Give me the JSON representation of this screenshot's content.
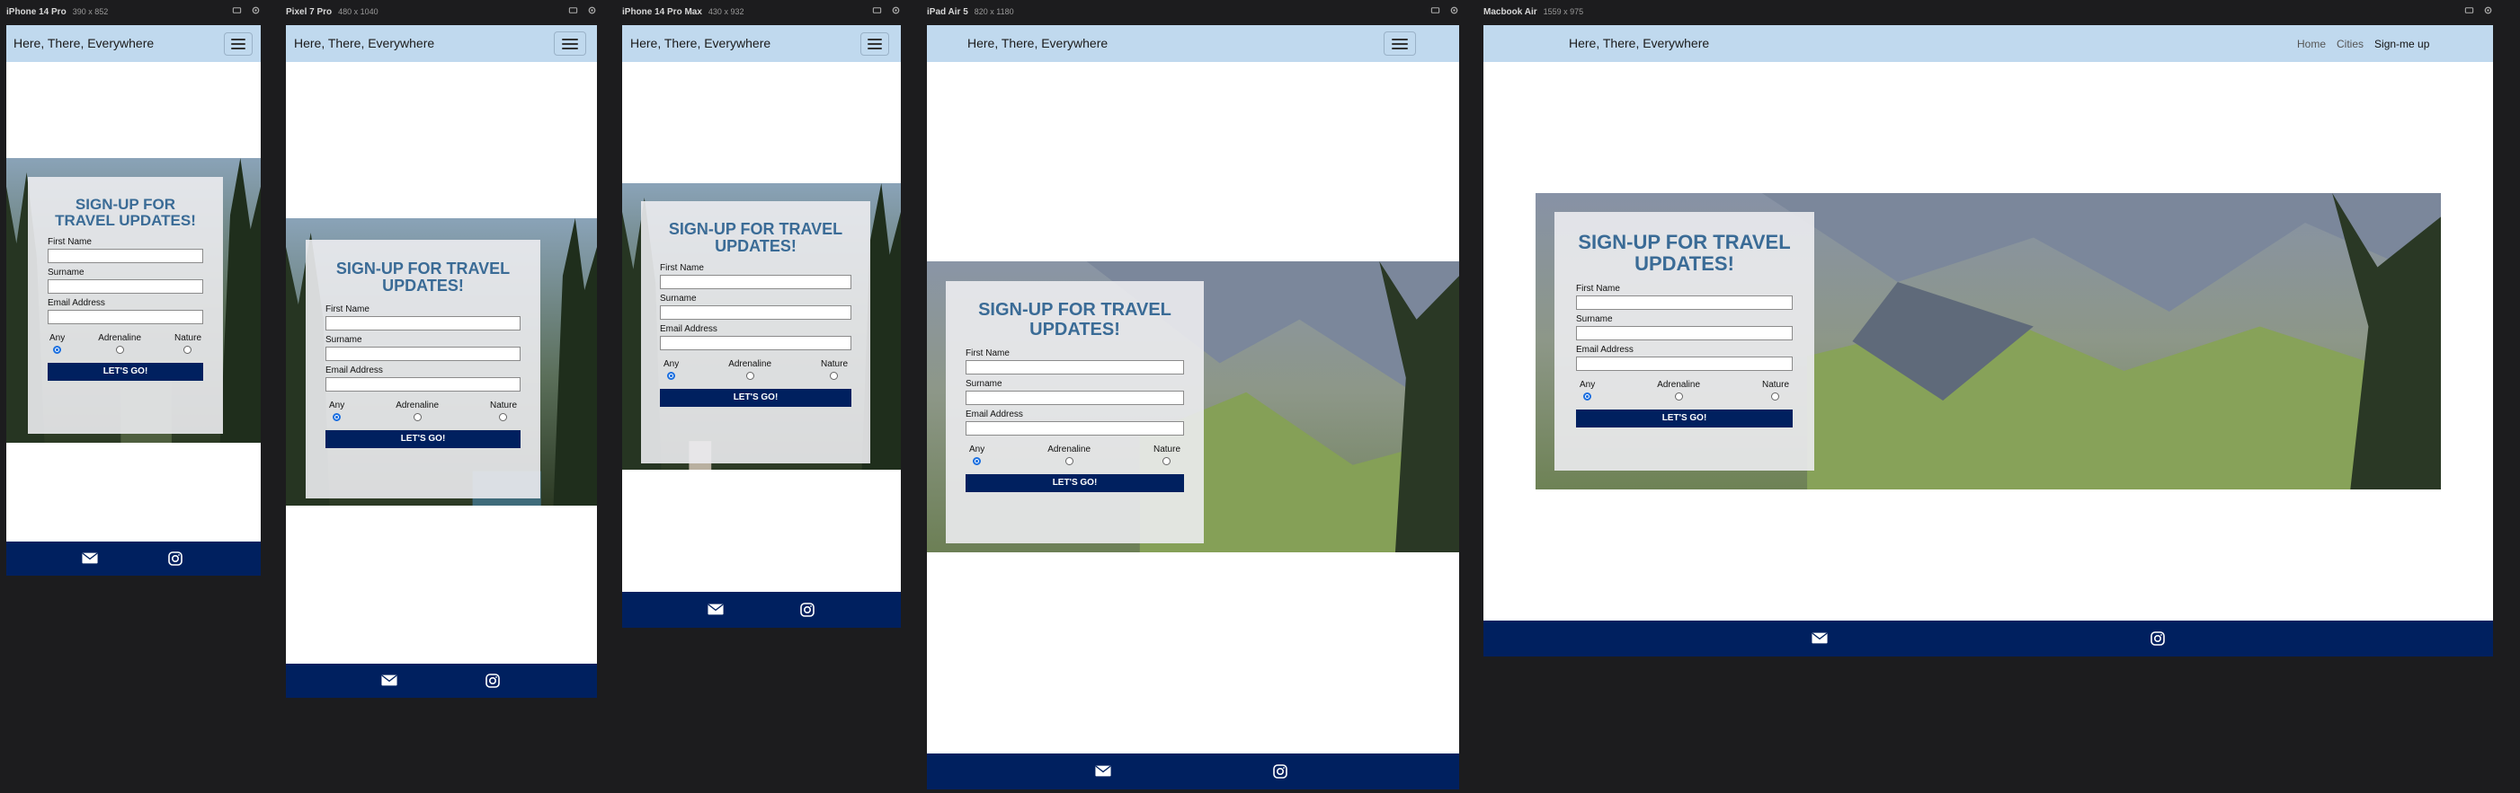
{
  "app": {
    "brand": "Here, There, Everywhere"
  },
  "devices": [
    {
      "name": "iPhone 14 Pro",
      "size": "390 x 852"
    },
    {
      "name": "Pixel 7 Pro",
      "size": "480 x 1040"
    },
    {
      "name": "iPhone 14 Pro Max",
      "size": "430 x 932"
    },
    {
      "name": "iPad Air 5",
      "size": "820 x 1180"
    },
    {
      "name": "Macbook Air",
      "size": "1559 x 975"
    }
  ],
  "nav": {
    "links": [
      "Home",
      "Cities",
      "Sign-me up"
    ],
    "active": "Sign-me up"
  },
  "form": {
    "title": "SIGN-UP FOR TRAVEL UPDATES!",
    "first_name_label": "First Name",
    "surname_label": "Surname",
    "email_label": "Email Address",
    "radio_options": [
      "Any",
      "Adrenaline",
      "Nature"
    ],
    "selected_option": "Any",
    "submit_label": "LET'S GO!"
  },
  "footer": {
    "icons": [
      "envelope-icon",
      "instagram-icon"
    ]
  },
  "colors": {
    "nav_bg": "#c0d9ee",
    "footer_bg": "#00205f",
    "button_bg": "#00205f",
    "title": "#3a6b96",
    "page_bg": "#1c1c1e"
  }
}
